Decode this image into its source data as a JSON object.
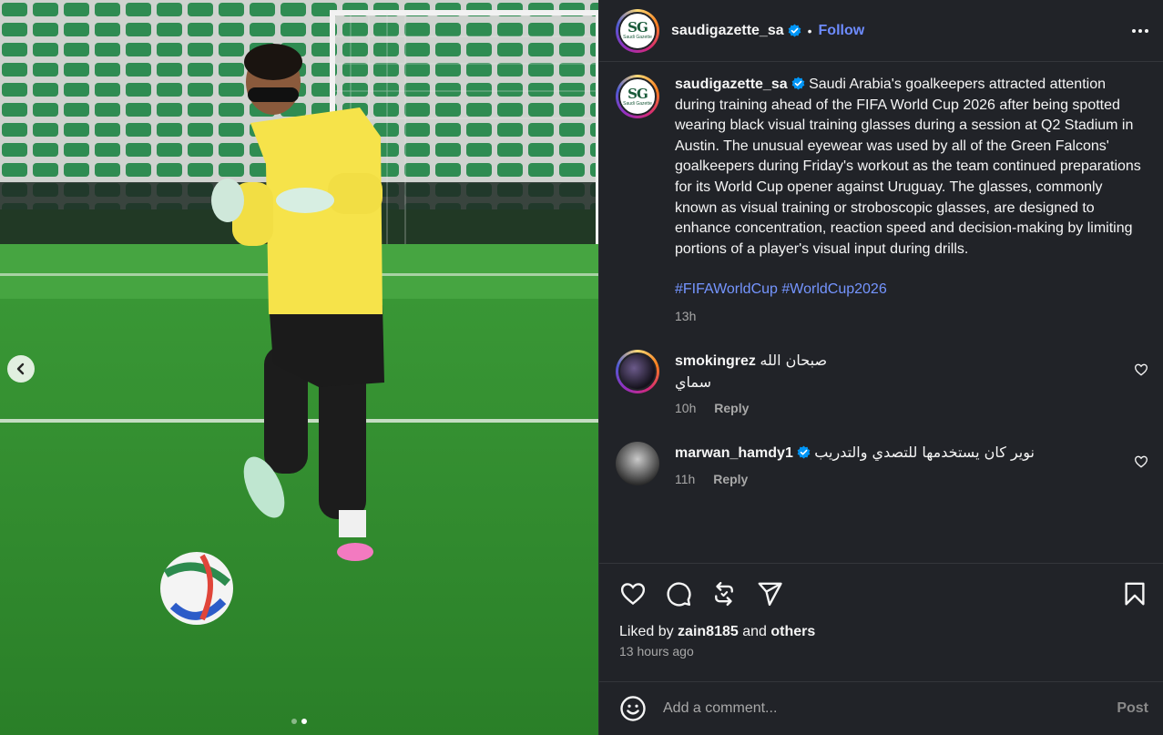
{
  "media": {
    "dots": [
      false,
      true
    ],
    "icons": {
      "prev": "chevron-left-icon"
    }
  },
  "header": {
    "username": "saudigazette_sa",
    "separator": "•",
    "follow_label": "Follow",
    "avatar_logo": "SG",
    "avatar_sub": "Saudi Gazette",
    "icons": {
      "verified": "verified-badge-icon",
      "more": "more-options-icon"
    }
  },
  "caption": {
    "username": "saudigazette_sa",
    "text": "Saudi Arabia's goalkeepers attracted attention during training ahead of the FIFA World Cup 2026 after being spotted wearing black visual training glasses during a session at Q2 Stadium in Austin. The unusual eyewear was used by all of the Green Falcons' goalkeepers during Friday's workout as the team continued preparations for its World Cup opener against Uruguay. The glasses, commonly known as visual training or stroboscopic glasses, are designed to enhance concentration, reaction speed and decision-making by limiting portions of a player's visual input during drills.",
    "hashtags": [
      "#FIFAWorldCup",
      "#WorldCup2026"
    ],
    "time": "13h"
  },
  "comments": [
    {
      "username": "smokingrez",
      "line1": "صبحان الله",
      "line2": "سماي",
      "time": "10h",
      "reply_label": "Reply",
      "verified": false
    },
    {
      "username": "marwan_hamdy1",
      "line1": "نوير كان يستخدمها للتصدي والتدريب",
      "time": "11h",
      "reply_label": "Reply",
      "verified": true
    }
  ],
  "actions": {
    "icons": [
      "heart-icon",
      "comment-icon",
      "repost-icon",
      "share-icon",
      "bookmark-icon"
    ],
    "liked_by_prefix": "Liked by",
    "liked_by_user": "zain8185",
    "liked_by_and": "and",
    "liked_by_others": "others",
    "time_ago": "13 hours ago"
  },
  "add_comment": {
    "placeholder": "Add a comment...",
    "post_label": "Post",
    "icons": {
      "emoji": "emoji-icon"
    }
  },
  "colors": {
    "background": "#212328",
    "link": "#6e8cff",
    "hashtag": "#7595ff",
    "muted": "#a8a8a8",
    "verified": "#0095f6"
  }
}
